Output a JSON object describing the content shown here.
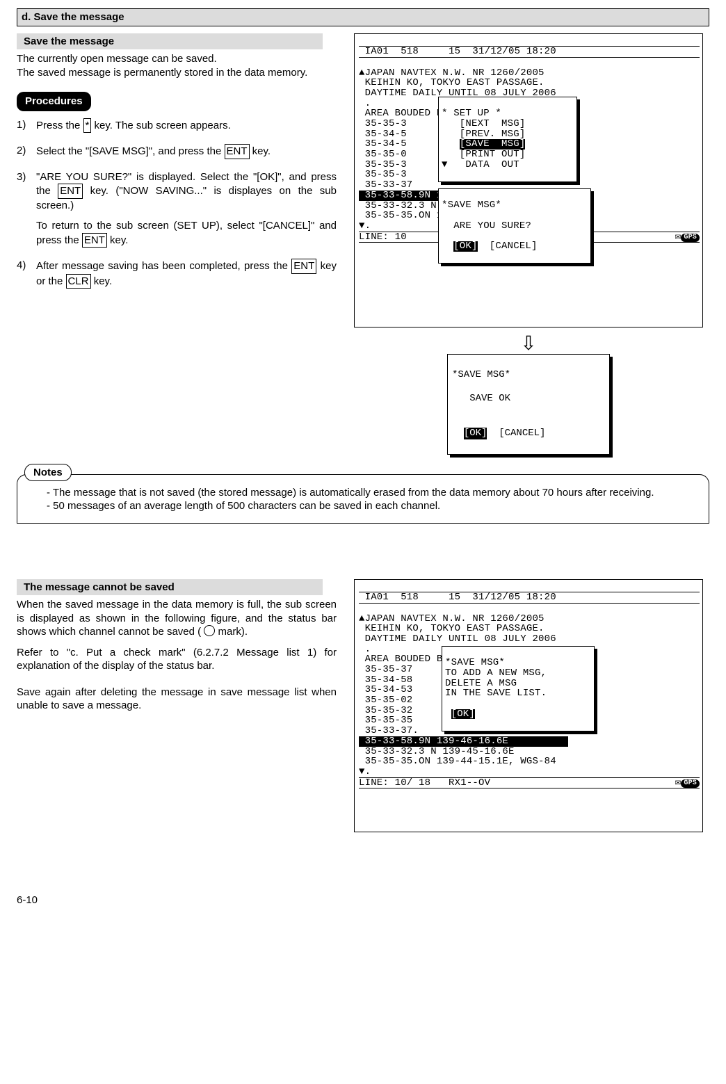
{
  "section_d_title": "d. Save the message",
  "save_msg_heading": "Save the message",
  "intro_para": "The currently open message can be saved.\nThe saved message is permanently stored in the data memory.",
  "procedures_label": "Procedures",
  "steps": {
    "s1a": "Press the ",
    "s1key": "*",
    "s1b": " key. The sub screen appears.",
    "s2a": "Select the \"[SAVE MSG]\", and press the ",
    "s2key": "ENT",
    "s2b": " key.",
    "s3a": "\"ARE YOU SURE?\" is displayed. Select the \"[OK]\", and press the ",
    "s3key": "ENT",
    "s3b": " key. (\"NOW SAVING...\" is displayes on the sub screen.)",
    "s3c": "To return to the sub screen (SET UP), select \"[CANCEL]\" and press the ",
    "s3key2": "ENT",
    "s3d": " key.",
    "s4a": "After message saving has been completed, press the ",
    "s4key1": "ENT",
    "s4b": " key or the ",
    "s4key2": "CLR",
    "s4c": " key."
  },
  "lcd1": {
    "top": " IA01  518     15  31/12/05 18:20",
    "body": "▲JAPAN NAVTEX N.W. NR 1260/2005\n KEIHIN KO, TOKYO EAST PASSAGE.\n DAYTIME DAILY UNTIL 08 JULY 2006\n .\n AREA BOUDED BY\n 35-35-3\n 35-34-5\n 35-34-5\n 35-35-0\n 35-35-3\n 35-35-3\n 35-33-37",
    "highlight": " 35-33-58.9N 139    6-16.6E        ",
    "body2": " 35-33-32.3 N 13   5-16.6E\n 35-35-35.ON 139   -15.1E, WGS-84\n▼.",
    "bottom_a": "LINE: 10",
    "gps": "GPS",
    "popup_setup": "* SET UP *\n   [NEXT  MSG]\n   [PREV. MSG]\n   ",
    "popup_setup_sel": "[SAVE  MSG]",
    "popup_setup2": "\n   [PRINT OUT]\n▼   DATA  OUT",
    "popup_save_title": "*SAVE MSG*",
    "popup_save_q": "  ARE YOU SURE?",
    "popup_ok": "[OK]",
    "popup_cancel": "  [CANCEL]"
  },
  "lcd1_result": {
    "title": "*SAVE MSG*",
    "body": "   SAVE OK",
    "ok": "[OK]",
    "cancel": "  [CANCEL]"
  },
  "notes_label": "Notes",
  "notes": {
    "n1": "- The message that is not saved (the stored message) is automatically erased from the data memory about 70 hours after receiving.",
    "n2": "- 50 messages of an average length of 500 characters can be saved in each channel."
  },
  "cannot_heading": "The message cannot be saved",
  "cannot_para1a": "When the saved message in the data memory is full, the sub screen is displayed as shown in the following figure, and the status bar shows which channel cannot be saved ( ",
  "cannot_para1b": " mark).",
  "cannot_para2": "Refer to \"c. Put a check mark\" (6.2.7.2 Message list 1) for explanation of the display of the status bar.",
  "cannot_para3": "Save again after deleting the message in save message list when unable to save a message.",
  "lcd2": {
    "top": " IA01  518     15  31/12/05 18:20",
    "body": "▲JAPAN NAVTEX N.W. NR 1260/2005\n KEIHIN KO, TOKYO EAST PASSAGE.\n DAYTIME DAILY UNTIL 08 JULY 2006\n .\n AREA BOUDED BY\n 35-35-37\n 35-34-58\n 35-34-53\n 35-35-02\n 35-35-32\n 35-35-35\n 35-33-37.",
    "highlight": " 35-33-58.9N 139-46-16.6E          ",
    "body2": " 35-33-32.3 N 139-45-16.6E\n 35-35-35.ON 139-44-15.1E, WGS-84\n▼.",
    "bottom": "LINE: 10/ 18   RX1--OV",
    "popup_title": "*SAVE MSG*",
    "popup_l1": "TO ADD A NEW MSG,",
    "popup_l2": "DELETE A MSG",
    "popup_l3": "IN THE SAVE LIST.",
    "popup_ok": "[OK]"
  },
  "page_number": "6-10"
}
